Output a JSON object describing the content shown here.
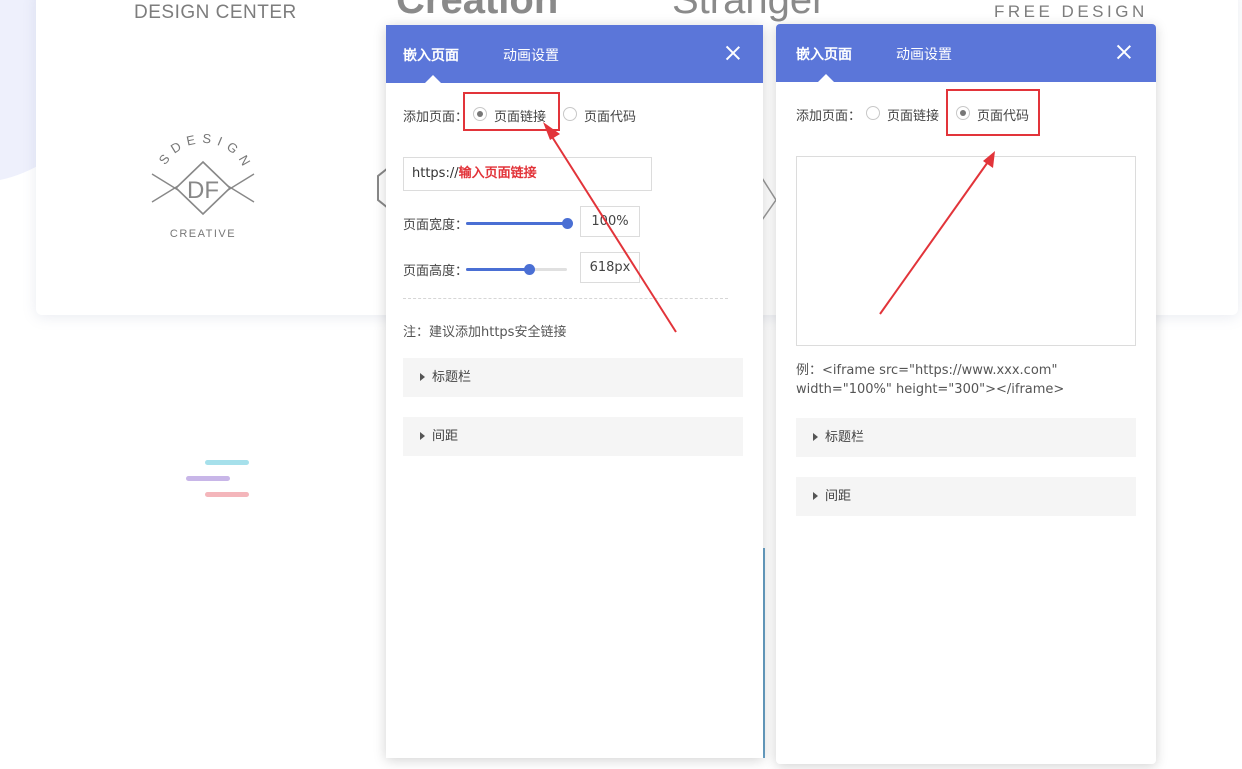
{
  "background": {
    "logos": {
      "design_center": "DESIGN CENTER",
      "free_design": "FREE DESIGN",
      "df_arc": "SDESIGN",
      "df_center": "DF",
      "df_bottom": "CREATIVE",
      "partial_left": "Creation",
      "partial_right": "Stranger"
    },
    "deco_colors": [
      "#a6e0eb",
      "#c8b6e8",
      "#f4b6bb"
    ]
  },
  "panel_left": {
    "tabs": [
      "嵌入页面",
      "动画设置"
    ],
    "add_page_label": "添加页面：",
    "radio_options": [
      {
        "label": "页面链接",
        "checked": true
      },
      {
        "label": "页面代码",
        "checked": false
      }
    ],
    "url_prefix": "https://",
    "url_placeholder": "输入页面链接",
    "width_label": "页面宽度：",
    "width_value": "100%",
    "width_fraction": 1.0,
    "height_label": "页面高度：",
    "height_value": "618px",
    "height_fraction": 0.62,
    "note": "注：建议添加https安全链接",
    "accordions": [
      "标题栏",
      "间距"
    ]
  },
  "panel_right": {
    "tabs": [
      "嵌入页面",
      "动画设置"
    ],
    "add_page_label": "添加页面：",
    "radio_options": [
      {
        "label": "页面链接",
        "checked": false
      },
      {
        "label": "页面代码",
        "checked": true
      }
    ],
    "code_value": "",
    "example": "例：<iframe src=\"https://www.xxx.com\" width=\"100%\" height=\"300\"></iframe>",
    "accordions": [
      "标题栏",
      "间距"
    ]
  },
  "colors": {
    "header": "#5b76d9",
    "highlight": "#e2343a",
    "slider": "#4a6fd4"
  }
}
